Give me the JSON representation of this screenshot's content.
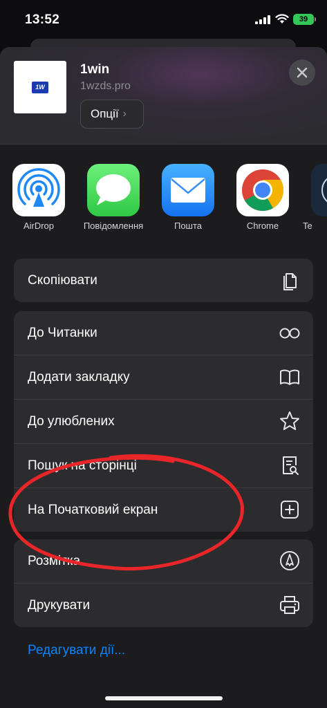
{
  "status_bar": {
    "time": "13:52",
    "battery": "39"
  },
  "header": {
    "site_name": "1win",
    "site_url": "1wzds.pro",
    "options_label": "Опції",
    "thumbnail_text": "1W"
  },
  "apps": [
    {
      "label": "AirDrop",
      "icon": "airdrop-icon"
    },
    {
      "label": "Повідомлення",
      "icon": "messages-icon"
    },
    {
      "label": "Пошта",
      "icon": "mail-icon"
    },
    {
      "label": "Chrome",
      "icon": "chrome-icon"
    },
    {
      "label": "Te",
      "icon": "app-icon"
    }
  ],
  "actions": {
    "group1": [
      {
        "label": "Скопіювати",
        "icon": "copy-icon"
      }
    ],
    "group2": [
      {
        "label": "До Читанки",
        "icon": "reader-glasses-icon"
      },
      {
        "label": "Додати закладку",
        "icon": "book-icon"
      },
      {
        "label": "До улюблених",
        "icon": "star-icon"
      },
      {
        "label": "Пошук на сторінці",
        "icon": "find-on-page-icon"
      },
      {
        "label": "На Початковий екран",
        "icon": "add-square-icon"
      }
    ],
    "group3": [
      {
        "label": "Розмітка",
        "icon": "markup-icon"
      },
      {
        "label": "Друкувати",
        "icon": "printer-icon"
      }
    ]
  },
  "edit_actions_label": "Редагувати дії...",
  "colors": {
    "link": "#0a84ff",
    "annotation": "#e8262a",
    "battery": "#34c759"
  }
}
